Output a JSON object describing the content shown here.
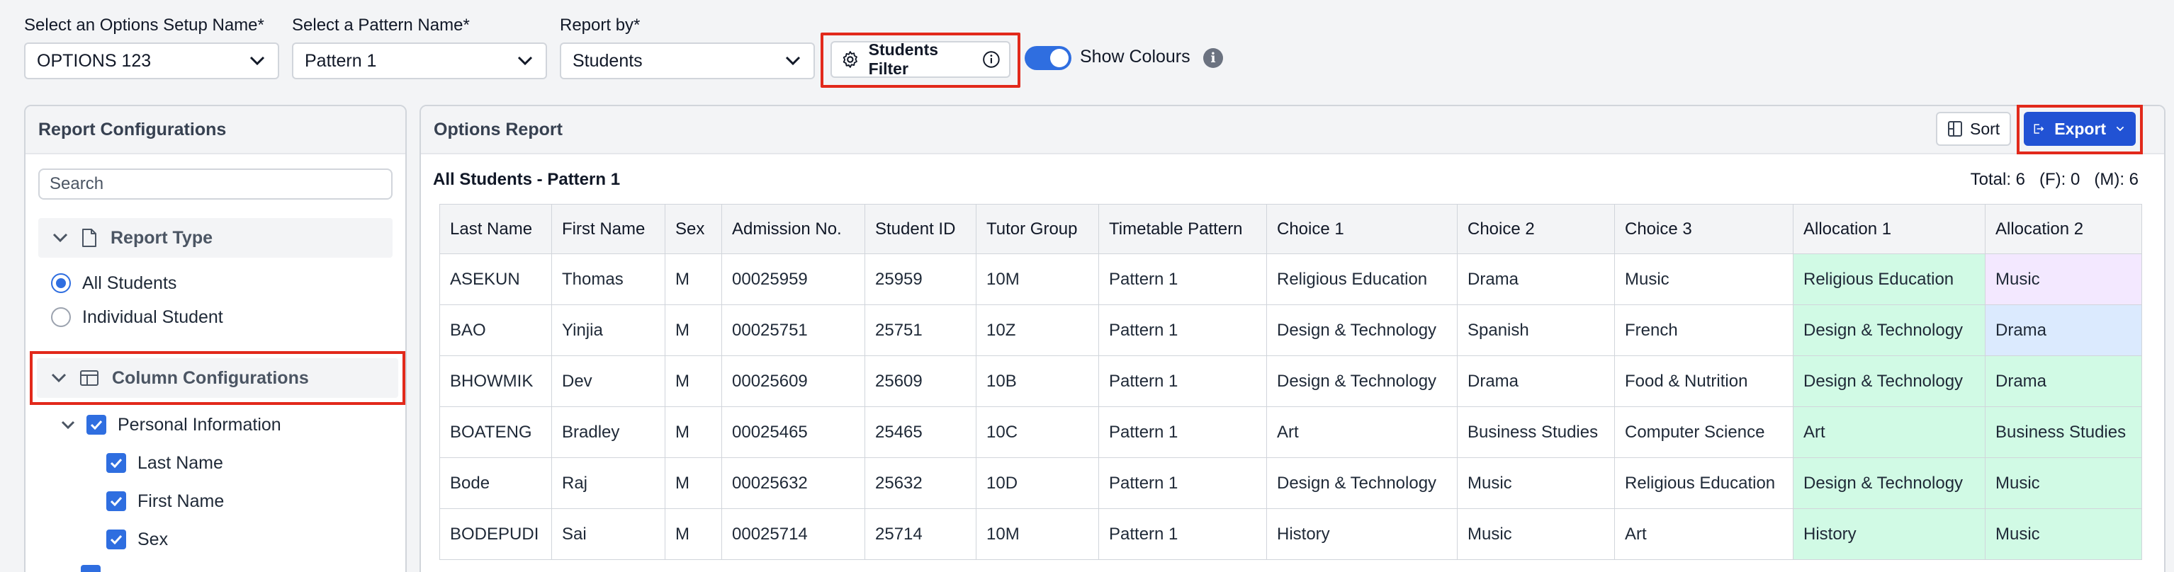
{
  "filters": {
    "options_setup": {
      "label": "Select an Options Setup Name*",
      "value": "OPTIONS 123"
    },
    "pattern": {
      "label": "Select a Pattern Name*",
      "value": "Pattern 1"
    },
    "report_by": {
      "label": "Report by*",
      "value": "Students"
    },
    "students_filter_label": "Students Filter",
    "show_colours_label": "Show Colours",
    "show_colours_on": true
  },
  "left_panel": {
    "title": "Report Configurations",
    "search_placeholder": "Search",
    "report_type": {
      "label": "Report Type",
      "options": [
        {
          "label": "All Students",
          "selected": true
        },
        {
          "label": "Individual Student",
          "selected": false
        }
      ]
    },
    "column_config": {
      "label": "Column Configurations",
      "group_label": "Personal Information",
      "items": [
        "Last Name",
        "First Name",
        "Sex"
      ]
    }
  },
  "report": {
    "title": "Options Report",
    "sort_label": "Sort",
    "export_label": "Export",
    "subtitle": "All Students - Pattern 1",
    "totals": "Total: 6   (F): 0   (M): 6",
    "columns": [
      "Last Name",
      "First Name",
      "Sex",
      "Admission No.",
      "Student ID",
      "Tutor Group",
      "Timetable Pattern",
      "Choice 1",
      "Choice 2",
      "Choice 3",
      "Allocation 1",
      "Allocation 2"
    ],
    "rows": [
      [
        "ASEKUN",
        "Thomas",
        "M",
        "00025959",
        "25959",
        "10M",
        "Pattern 1",
        "Religious Education",
        "Drama",
        "Music",
        "Religious Education",
        "Music"
      ],
      [
        "BAO",
        "Yinjia",
        "M",
        "00025751",
        "25751",
        "10Z",
        "Pattern 1",
        "Design & Technology",
        "Spanish",
        "French",
        "Design & Technology",
        "Drama"
      ],
      [
        "BHOWMIK",
        "Dev",
        "M",
        "00025609",
        "25609",
        "10B",
        "Pattern 1",
        "Design & Technology",
        "Drama",
        "Food & Nutrition",
        "Design & Technology",
        "Drama"
      ],
      [
        "BOATENG",
        "Bradley",
        "M",
        "00025465",
        "25465",
        "10C",
        "Pattern 1",
        "Art",
        "Business Studies",
        "Computer Science",
        "Art",
        "Business Studies"
      ],
      [
        "Bode",
        "Raj",
        "M",
        "00025632",
        "25632",
        "10D",
        "Pattern 1",
        "Design & Technology",
        "Music",
        "Religious Education",
        "Design & Technology",
        "Music"
      ],
      [
        "BODEPUDI",
        "Sai",
        "M",
        "00025714",
        "25714",
        "10M",
        "Pattern 1",
        "History",
        "Music",
        "Art",
        "History",
        "Music"
      ]
    ],
    "allocation_colours": [
      [
        "green",
        "purple"
      ],
      [
        "green",
        "blue"
      ],
      [
        "green",
        "green"
      ],
      [
        "green",
        "green"
      ],
      [
        "green",
        "green"
      ],
      [
        "green",
        "green"
      ]
    ]
  },
  "colors": {
    "accent": "#2f6ee0",
    "export": "#2152d4",
    "highlight": "#e2291b",
    "green": "#d1fae5",
    "purple": "#f3e8ff",
    "blue": "#dbeafe"
  }
}
